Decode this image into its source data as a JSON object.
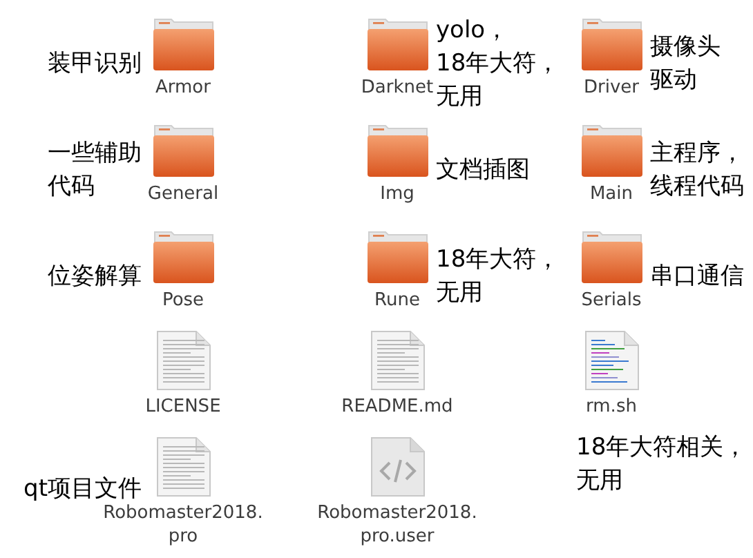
{
  "items": [
    {
      "kind": "folder",
      "label": [
        "Armor"
      ],
      "note": [
        "装甲识别"
      ]
    },
    {
      "kind": "folder",
      "label": [
        "Darknet"
      ],
      "note": [
        "yolo，",
        "18年大符，",
        "无用"
      ]
    },
    {
      "kind": "folder",
      "label": [
        "Driver"
      ],
      "note": [
        "摄像头",
        "驱动"
      ]
    },
    {
      "kind": "folder",
      "label": [
        "General"
      ],
      "note": [
        "一些辅助",
        "代码"
      ]
    },
    {
      "kind": "folder",
      "label": [
        "Img"
      ],
      "note": [
        "文档插图"
      ]
    },
    {
      "kind": "folder",
      "label": [
        "Main"
      ],
      "note": [
        "主程序，",
        "线程代码"
      ]
    },
    {
      "kind": "folder",
      "label": [
        "Pose"
      ],
      "note": [
        "位姿解算"
      ]
    },
    {
      "kind": "folder",
      "label": [
        "Rune"
      ],
      "note": [
        "18年大符，",
        "无用"
      ]
    },
    {
      "kind": "folder",
      "label": [
        "Serials"
      ],
      "note": [
        "串口通信"
      ]
    },
    {
      "kind": "text-file",
      "label": [
        "LICENSE"
      ]
    },
    {
      "kind": "text-file",
      "label": [
        "README.md"
      ]
    },
    {
      "kind": "script-file",
      "label": [
        "rm.sh"
      ]
    },
    {
      "kind": "text-file",
      "label": [
        "Robomaster2018.",
        "pro"
      ],
      "note": [
        "qt项目文件"
      ]
    },
    {
      "kind": "code-file",
      "label": [
        "Robomaster2018.",
        "pro.user"
      ]
    },
    {
      "kind": "empty",
      "note": [
        "18年大符相关，",
        "无用"
      ]
    }
  ]
}
